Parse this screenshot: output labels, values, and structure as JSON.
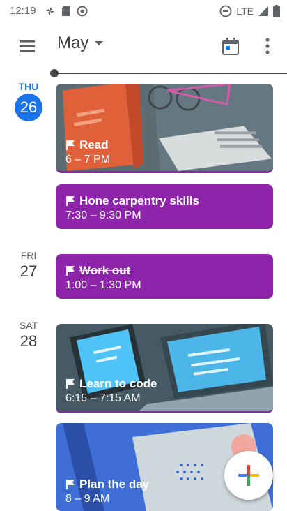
{
  "status_bar": {
    "time": "12:19",
    "network": "LTE"
  },
  "app_bar": {
    "month": "May",
    "icons": [
      "menu-icon",
      "chevron-down-icon",
      "calendar-today-icon",
      "more-vert-icon"
    ]
  },
  "days": [
    {
      "dow": "THU",
      "dom": "26",
      "today": true
    },
    {
      "dow": "FRI",
      "dom": "27",
      "today": false
    },
    {
      "dow": "SAT",
      "dom": "28",
      "today": false
    }
  ],
  "events": [
    {
      "title": "Read",
      "time": "6 – 7 PM",
      "style": "image"
    },
    {
      "title": "Hone carpentry skills",
      "time": "7:30 – 9:30 PM",
      "style": "purple"
    },
    {
      "title": "Work out",
      "time": "1:00 – 1:30 PM",
      "style": "purple",
      "struck": true
    },
    {
      "title": "Learn to code",
      "time": "6:15 – 7:15 AM",
      "style": "image"
    },
    {
      "title": "Plan the day",
      "time": "8 – 9 AM",
      "style": "image"
    }
  ],
  "colors": {
    "accent": "#1a73e8",
    "event_purple": "#8e24aa"
  }
}
